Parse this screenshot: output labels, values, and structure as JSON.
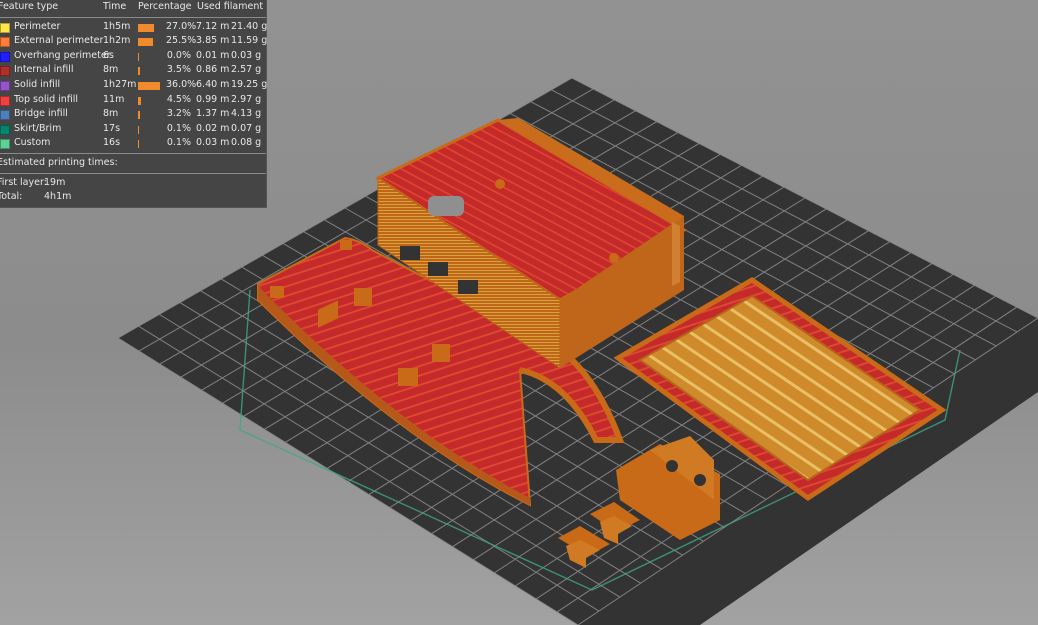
{
  "legend": {
    "header": {
      "feature_type": "Feature type",
      "time": "Time",
      "percentage": "Percentage",
      "used_filament": "Used filament"
    },
    "rows": [
      {
        "name": "Perimeter",
        "time": "1h5m",
        "percentage": "27.0%",
        "fraction": 0.27,
        "length": "7.12 m",
        "weight": "21.40 g",
        "color": "#ffe64d"
      },
      {
        "name": "External perimeter",
        "time": "1h2m",
        "percentage": "25.5%",
        "fraction": 0.255,
        "length": "3.85 m",
        "weight": "11.59 g",
        "color": "#ff7d38"
      },
      {
        "name": "Overhang perimeter",
        "time": "6s",
        "percentage": "0.0%",
        "fraction": 0.0,
        "length": "0.01 m",
        "weight": "0.03 g",
        "color": "#1f1fff"
      },
      {
        "name": "Internal infill",
        "time": "8m",
        "percentage": "3.5%",
        "fraction": 0.035,
        "length": "0.86 m",
        "weight": "2.57 g",
        "color": "#b03029"
      },
      {
        "name": "Solid infill",
        "time": "1h27m",
        "percentage": "36.0%",
        "fraction": 0.36,
        "length": "6.40 m",
        "weight": "19.25 g",
        "color": "#9654cc"
      },
      {
        "name": "Top solid infill",
        "time": "11m",
        "percentage": "4.5%",
        "fraction": 0.045,
        "length": "0.99 m",
        "weight": "2.97 g",
        "color": "#f04040"
      },
      {
        "name": "Bridge infill",
        "time": "8m",
        "percentage": "3.2%",
        "fraction": 0.032,
        "length": "1.37 m",
        "weight": "4.13 g",
        "color": "#4d80ba"
      },
      {
        "name": "Skirt/Brim",
        "time": "17s",
        "percentage": "0.1%",
        "fraction": 0.001,
        "length": "0.02 m",
        "weight": "0.07 g",
        "color": "#00876e"
      },
      {
        "name": "Custom",
        "time": "16s",
        "percentage": "0.1%",
        "fraction": 0.001,
        "length": "0.03 m",
        "weight": "0.08 g",
        "color": "#5ed194"
      }
    ],
    "estimated_title": "Estimated printing times:",
    "first_layer_label": "First layer:",
    "first_layer_value": "19m",
    "total_label": "Total:",
    "total_value": "4h1m"
  },
  "colors": {
    "bed": "#333333",
    "grid": "#8a8a8a",
    "perimeter": "#c86a18",
    "infill": "#c42a2a",
    "skirt": "#3ea88a",
    "background": "#8f8f8f"
  }
}
